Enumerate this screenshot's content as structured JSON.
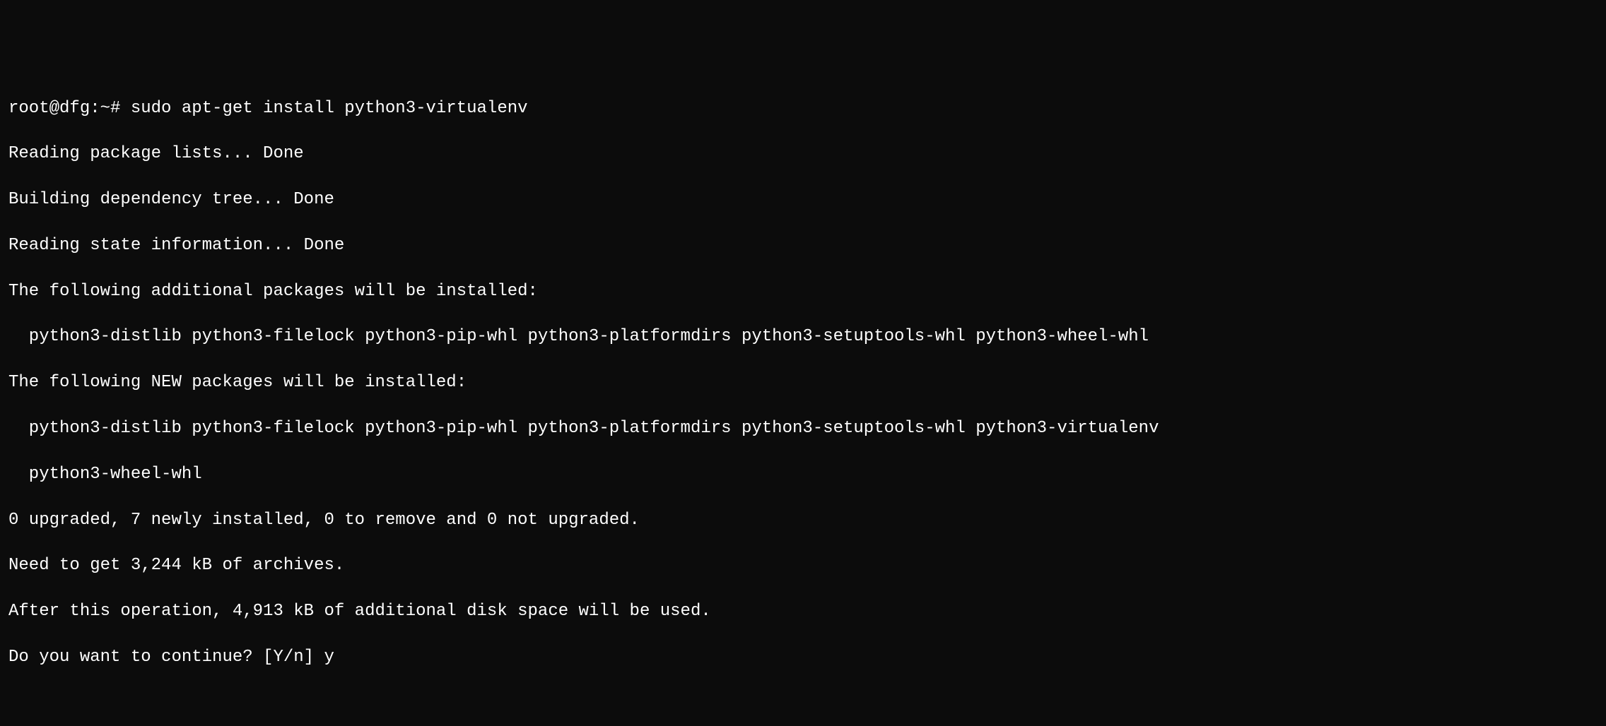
{
  "terminal": {
    "prompt": "root@dfg:~# ",
    "command": "sudo apt-get install python3-virtualenv",
    "lines": {
      "reading_pkg": "Reading package lists... Done",
      "building_dep": "Building dependency tree... Done",
      "reading_state": "Reading state information... Done",
      "additional_header": "The following additional packages will be installed:",
      "additional_pkgs": "  python3-distlib python3-filelock python3-pip-whl python3-platformdirs python3-setuptools-whl python3-wheel-whl",
      "new_header": "The following NEW packages will be installed:",
      "new_pkgs_1": "  python3-distlib python3-filelock python3-pip-whl python3-platformdirs python3-setuptools-whl python3-virtualenv",
      "new_pkgs_2": "  python3-wheel-whl",
      "upgrade_summary": "0 upgraded, 7 newly installed, 0 to remove and 0 not upgraded.",
      "need_get": "Need to get 3,244 kB of archives.",
      "after_op": "After this operation, 4,913 kB of additional disk space will be used.",
      "continue_prompt": "Do you want to continue? [Y/n] ",
      "continue_answer": "y"
    }
  }
}
